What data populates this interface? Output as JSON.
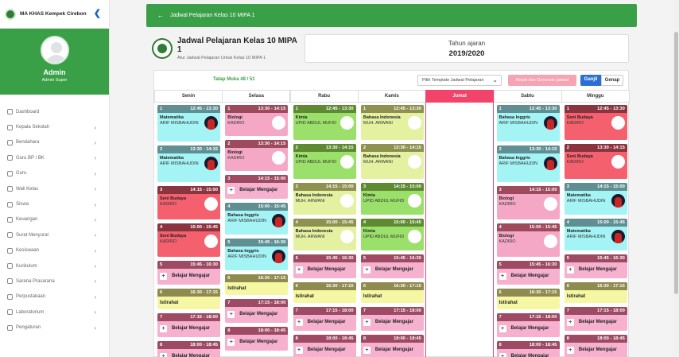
{
  "sidebar": {
    "school": "MA KHAS Kempek Cirebon",
    "user": "Admin",
    "role": "Admin Super",
    "menu": [
      {
        "label": "Dashboard",
        "chev": false
      },
      {
        "label": "Kepala Sekolah",
        "chev": true
      },
      {
        "label": "Bendahara",
        "chev": true
      },
      {
        "label": "Guru BP / BK",
        "chev": true
      },
      {
        "label": "Guru",
        "chev": true
      },
      {
        "label": "Wali Kelas",
        "chev": true
      },
      {
        "label": "Siswa",
        "chev": true
      },
      {
        "label": "Keuangan",
        "chev": true
      },
      {
        "label": "Surat Menyurat",
        "chev": true
      },
      {
        "label": "Kesiswaan",
        "chev": true
      },
      {
        "label": "Kurikulum",
        "chev": true
      },
      {
        "label": "Sarana Prasarana",
        "chev": true
      },
      {
        "label": "Perpustakaan",
        "chev": true
      },
      {
        "label": "Laboratorium",
        "chev": true
      },
      {
        "label": "Pengaturan",
        "chev": true
      }
    ]
  },
  "header": {
    "title": "Jadwal Pelajaran Kelas 10 MIPA 1"
  },
  "page": {
    "title": "Jadwal Pelajaran Kelas 10 MIPA 1",
    "subtitle": "Atur Jadwal Pelajaran Untuk Kelas 10 MIPA 1",
    "year_label": "Tahun ajaran",
    "year": "2019/2020"
  },
  "toolbar": {
    "tatap_muka": "Tatap Muka 48 / 51",
    "template_placeholder": "Pilih Template Jadwal Pelajaran",
    "reset_label": "Reset dan Generate jadwal",
    "ganjil": "Ganjil",
    "genap": "Genap"
  },
  "add_label": "Belajar Mengajar",
  "days": [
    {
      "name": "Senin",
      "slots": [
        {
          "n": "1",
          "time": "12:45 - 13:30",
          "type": "class",
          "color": "teal",
          "subject": "Matematika",
          "teacher": "ARIF MISBAHUDIN",
          "photo": true
        },
        {
          "n": "2",
          "time": "13:30 - 14:15",
          "type": "class",
          "color": "teal",
          "subject": "Matematika",
          "teacher": "ARIF MISBAHUDIN",
          "photo": true
        },
        {
          "n": "3",
          "time": "14:15 - 15:00",
          "type": "class",
          "color": "red",
          "subject": "Seni Budaya",
          "teacher": "KADIRO",
          "photo": false
        },
        {
          "n": "4",
          "time": "15:00 - 15:45",
          "type": "class",
          "color": "red",
          "subject": "Seni Budaya",
          "teacher": "KADIRO",
          "photo": false
        },
        {
          "n": "5",
          "time": "15:45 - 16:30",
          "type": "add",
          "color": "rose"
        },
        {
          "n": "6",
          "time": "16:30 - 17:15",
          "type": "break",
          "color": "yellow",
          "label": "Istirahat"
        },
        {
          "n": "7",
          "time": "17:15 - 18:00",
          "type": "add",
          "color": "rose"
        },
        {
          "n": "8",
          "time": "18:00 - 18:45",
          "type": "add",
          "color": "rose"
        }
      ]
    },
    {
      "name": "Selasa",
      "slots": [
        {
          "n": "1",
          "time": "13:30 - 14:15",
          "type": "class",
          "color": "pink",
          "subject": "Biologi",
          "teacher": "KADIRO",
          "photo": false
        },
        {
          "n": "2",
          "time": "13:30 - 14:15",
          "type": "class",
          "color": "pink",
          "subject": "Biologi",
          "teacher": "KADIRO",
          "photo": false
        },
        {
          "n": "3",
          "time": "14:15 - 15:00",
          "type": "add",
          "color": "rose"
        },
        {
          "n": "4",
          "time": "15:00 - 15:45",
          "type": "class",
          "color": "teal",
          "subject": "Bahasa Inggris",
          "teacher": "ARIF MISBAHUDIN",
          "photo": true
        },
        {
          "n": "5",
          "time": "15:45 - 16:30",
          "type": "class",
          "color": "teal",
          "subject": "Bahasa Inggris",
          "teacher": "ARIF MISBAHUDIN",
          "photo": true
        },
        {
          "n": "6",
          "time": "16:30 - 17:15",
          "type": "break",
          "color": "yellow",
          "label": "Istirahat"
        },
        {
          "n": "7",
          "time": "17:15 - 18:00",
          "type": "add",
          "color": "rose"
        },
        {
          "n": "8",
          "time": "18:00 - 18:45",
          "type": "add",
          "color": "rose"
        }
      ]
    },
    {
      "name": "Rabu",
      "slots": [
        {
          "n": "1",
          "time": "12:45 - 13:30",
          "type": "class",
          "color": "green",
          "subject": "Kimia",
          "teacher": "UPID ABDUL MUFID",
          "photo": false
        },
        {
          "n": "2",
          "time": "13:30 - 14:15",
          "type": "class",
          "color": "green",
          "subject": "Kimia",
          "teacher": "UPID ABDUL MUFID",
          "photo": false
        },
        {
          "n": "3",
          "time": "14:15 - 15:00",
          "type": "class",
          "color": "lime",
          "subject": "Bahasa Indonesia",
          "teacher": "MUH. ARWANI",
          "photo": false
        },
        {
          "n": "4",
          "time": "15:00 - 15:45",
          "type": "class",
          "color": "lime",
          "subject": "Bahasa Indonesia",
          "teacher": "MUH. ARWANI",
          "photo": false
        },
        {
          "n": "5",
          "time": "15:45 - 16:30",
          "type": "add",
          "color": "rose"
        },
        {
          "n": "6",
          "time": "16:30 - 17:15",
          "type": "break",
          "color": "yellow",
          "label": "Istirahat"
        },
        {
          "n": "7",
          "time": "17:15 - 18:00",
          "type": "add",
          "color": "rose"
        },
        {
          "n": "8",
          "time": "18:00 - 18:45",
          "type": "add",
          "color": "rose"
        }
      ]
    },
    {
      "name": "Kamis",
      "slots": [
        {
          "n": "1",
          "time": "12:45 - 13:30",
          "type": "class",
          "color": "lime",
          "subject": "Bahasa Indonesia",
          "teacher": "MUH. ARWANI",
          "photo": false
        },
        {
          "n": "2",
          "time": "13:30 - 14:15",
          "type": "class",
          "color": "lime",
          "subject": "Bahasa Indonesia",
          "teacher": "MUH. ARWANI",
          "photo": false
        },
        {
          "n": "3",
          "time": "14:15 - 15:00",
          "type": "class",
          "color": "green",
          "subject": "Kimia",
          "teacher": "UPID ABDUL MUFID",
          "photo": false
        },
        {
          "n": "4",
          "time": "15:00 - 15:45",
          "type": "class",
          "color": "green",
          "subject": "Kimia",
          "teacher": "UPID ABDUL MUFID",
          "photo": false
        },
        {
          "n": "5",
          "time": "15:45 - 16:30",
          "type": "add",
          "color": "rose"
        },
        {
          "n": "6",
          "time": "16:30 - 17:15",
          "type": "break",
          "color": "yellow",
          "label": "Istirahat"
        },
        {
          "n": "7",
          "time": "17:15 - 18:00",
          "type": "add",
          "color": "rose"
        },
        {
          "n": "8",
          "time": "18:00 - 18:45",
          "type": "add",
          "color": "rose"
        }
      ]
    },
    {
      "name": "Jumat",
      "slots": []
    },
    {
      "name": "Sabtu",
      "slots": [
        {
          "n": "1",
          "time": "12:45 - 13:30",
          "type": "class",
          "color": "teal",
          "subject": "Bahasa Inggris",
          "teacher": "ARIF MISBAHUDIN",
          "photo": true
        },
        {
          "n": "2",
          "time": "13:30 - 14:15",
          "type": "class",
          "color": "teal",
          "subject": "Bahasa Inggris",
          "teacher": "ARIF MISBAHUDIN",
          "photo": true
        },
        {
          "n": "3",
          "time": "14:15 - 15:00",
          "type": "class",
          "color": "pink",
          "subject": "Biologi",
          "teacher": "KADIRO",
          "photo": false
        },
        {
          "n": "4",
          "time": "15:00 - 15:45",
          "type": "class",
          "color": "pink",
          "subject": "Biologi",
          "teacher": "KADIRO",
          "photo": false
        },
        {
          "n": "5",
          "time": "15:45 - 16:30",
          "type": "add",
          "color": "rose"
        },
        {
          "n": "6",
          "time": "16:30 - 17:15",
          "type": "break",
          "color": "yellow",
          "label": "Istirahat"
        },
        {
          "n": "7",
          "time": "17:15 - 18:00",
          "type": "add",
          "color": "rose"
        },
        {
          "n": "8",
          "time": "18:00 - 18:45",
          "type": "add",
          "color": "rose"
        }
      ]
    },
    {
      "name": "Minggu",
      "slots": [
        {
          "n": "1",
          "time": "12:45 - 13:30",
          "type": "class",
          "color": "red",
          "subject": "Seni Budaya",
          "teacher": "KADIRO",
          "photo": false
        },
        {
          "n": "2",
          "time": "13:30 - 14:15",
          "type": "class",
          "color": "red",
          "subject": "Seni Budaya",
          "teacher": "KADIRO",
          "photo": false
        },
        {
          "n": "3",
          "time": "14:15 - 15:00",
          "type": "class",
          "color": "teal",
          "subject": "Matematika",
          "teacher": "ARIF MISBAHUDIN",
          "photo": true
        },
        {
          "n": "4",
          "time": "15:00 - 15:45",
          "type": "class",
          "color": "teal",
          "subject": "Matematika",
          "teacher": "ARIF MISBAHUDIN",
          "photo": true
        },
        {
          "n": "5",
          "time": "15:45 - 16:30",
          "type": "add",
          "color": "rose"
        },
        {
          "n": "6",
          "time": "16:30 - 17:15",
          "type": "break",
          "color": "yellow",
          "label": "Istirahat"
        },
        {
          "n": "7",
          "time": "17:15 - 18:00",
          "type": "add",
          "color": "rose"
        },
        {
          "n": "8",
          "time": "18:00 - 18:45",
          "type": "add",
          "color": "rose"
        }
      ]
    }
  ]
}
